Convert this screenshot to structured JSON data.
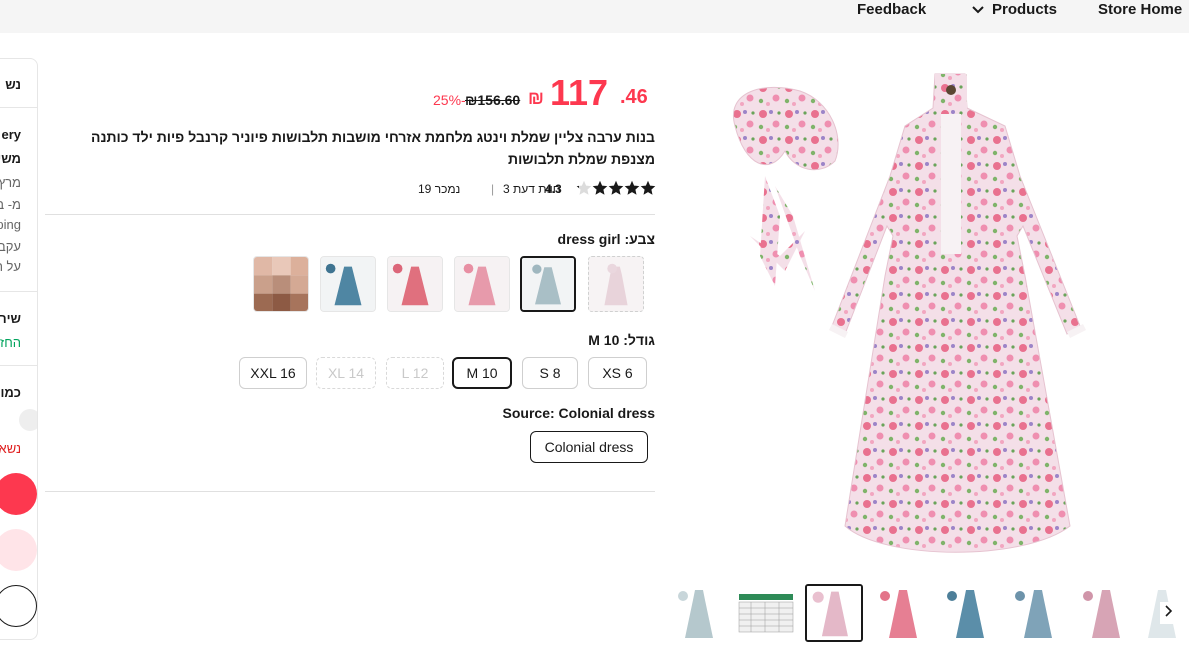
{
  "nav": {
    "feedback": "Feedback",
    "products": "Products",
    "store_home": "Store Home"
  },
  "sidebar": {
    "line1": "נש",
    "line2": "ery",
    "line3": "משי",
    "line4": "מרץ",
    "line5": "מ- ב",
    "line6": "ping",
    "line7": "עקב",
    "line8": "על ה",
    "line9": "שיר",
    "line10": "החז",
    "line11": "כמו",
    "line12": "נשא"
  },
  "price": {
    "integer": "117",
    "decimal": ".46",
    "currency": "₪",
    "original": "₪156.60",
    "discount": "25%-"
  },
  "product": {
    "title": "בנות ערבה צליין שמלת וינטג מלחמת אזרחי מושבות תלבושות פיוניר קרנבל פיות ילד כותנה מצנפת שמלת תלבושות",
    "rating": "4.3",
    "reviews": "3 חוות דעת",
    "separator": "|",
    "sold": "19 נמכר"
  },
  "color": {
    "label": "צבע: dress girl"
  },
  "size": {
    "label": "גודל: M 10",
    "options": [
      "XS 6",
      "S 8",
      "M 10",
      "L 12",
      "XL 14",
      "XXL 16"
    ]
  },
  "source": {
    "label": "Source: Colonial dress",
    "option": "Colonial dress"
  },
  "colors": {
    "accent": "#fd384f",
    "text": "#191919",
    "green": "#00a35c"
  },
  "icons": {
    "products_chevron": "chevron-down-icon",
    "next_arrow": "chevron-right-icon",
    "rating": "star-icon"
  }
}
